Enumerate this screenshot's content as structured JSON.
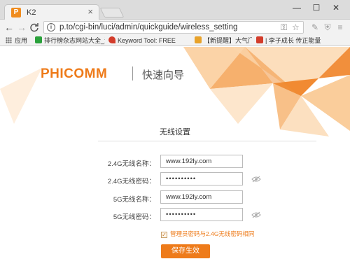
{
  "browser": {
    "tab": {
      "title": "K2",
      "favicon": "P",
      "close": "×"
    },
    "window": {
      "minimize": "—",
      "maximize": "☐",
      "close": "✕"
    },
    "nav": {
      "back": "←",
      "forward": "→",
      "reload": "C"
    },
    "address": {
      "info": "i",
      "url": "p.to/cgi-bin/luci/admin/quickguide/wireless_setting"
    },
    "bookmarks": [
      {
        "label": "应用",
        "icon": "apps-grid-icon"
      },
      {
        "label": "排行榜杂志网站大全_沪",
        "icon": "bookmark-site-icon",
        "color": "#2aa13b"
      },
      {
        "label": "Keyword Tool: FREE",
        "icon": "keyword-tool-icon",
        "color": "#d33c2b"
      },
      {
        "label": "【新提醒】大气门户",
        "icon": "bookmark-page-icon",
        "color": "#e8a22a"
      },
      {
        "label": "| 李子成长 传正能量",
        "icon": "bookmark-page-icon",
        "color": "#d33c2b"
      }
    ]
  },
  "page": {
    "brand": "PHICOMM",
    "brand_sub": "快速向导",
    "title": "无线设置",
    "fields": {
      "ssid_24": {
        "label": "2.4G无线名称：",
        "value": "www.192ly.com"
      },
      "pwd_24": {
        "label": "2.4G无线密码：",
        "value": "••••••••••"
      },
      "ssid_5": {
        "label": "5G无线名称：",
        "value": "www.192ly.com"
      },
      "pwd_5": {
        "label": "5G无线密码：",
        "value": "••••••••••"
      }
    },
    "checkbox": {
      "label": "管理员密码与2.4G无线密码相同",
      "checked": true
    },
    "save_label": "保存生效"
  },
  "colors": {
    "accent": "#ee7b1a",
    "accent_light": "#f9c48a"
  }
}
